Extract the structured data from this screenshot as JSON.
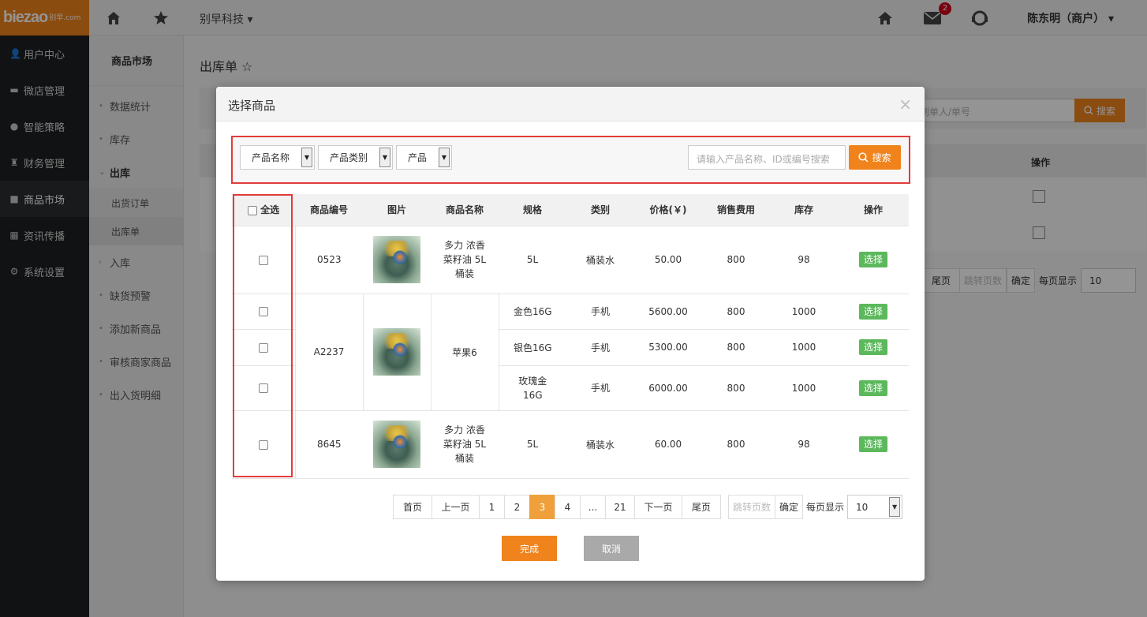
{
  "logo": {
    "text": "biezao",
    "small": "别早.com"
  },
  "sidebar": {
    "items": [
      {
        "label": "用户中心",
        "icon": "user-icon",
        "glyph": "👤"
      },
      {
        "label": "微店管理",
        "icon": "store-icon",
        "glyph": "▬"
      },
      {
        "label": "智能策略",
        "icon": "strategy-icon",
        "glyph": "●"
      },
      {
        "label": "财务管理",
        "icon": "finance-icon",
        "glyph": "♜"
      },
      {
        "label": "商品市场",
        "icon": "market-icon",
        "glyph": "■"
      },
      {
        "label": "资讯传播",
        "icon": "news-icon",
        "glyph": "▦"
      },
      {
        "label": "系统设置",
        "icon": "settings-icon",
        "glyph": "⚙"
      }
    ]
  },
  "topbar": {
    "company": "别早科技 ▾",
    "user": "陈东明（商户） ▾",
    "mail_badge": "2"
  },
  "subnav": {
    "title": "商品市场",
    "items": {
      "stats": "数据统计",
      "stock": "库存",
      "outbound": "出库",
      "out_order": "出货订单",
      "out_list": "出库单",
      "inbound": "入库",
      "shortage": "缺货预警",
      "add_new": "添加新商品",
      "review": "审核商家商品",
      "detail": "出入货明细"
    }
  },
  "page": {
    "title": "出库单 ☆",
    "search_placeholder": "刷单人/单号",
    "search_button": "搜索",
    "bg_op_header": "操作",
    "bg_pager": {
      "last": "尾页",
      "jump": "跳转页数",
      "confirm": "确定",
      "per_page": "每页显示",
      "per_page_value": "10"
    }
  },
  "modal": {
    "title": "选择商品",
    "close": "×",
    "filters": {
      "name": "产品名称",
      "category": "产品类别",
      "product": "产品"
    },
    "search_placeholder": "请输入产品名称、ID或编号搜索",
    "search_button": "搜索",
    "headers": {
      "select_all": "全选",
      "code": "商品编号",
      "image": "图片",
      "name": "商品名称",
      "spec": "规格",
      "type": "类别",
      "price": "价格(￥)",
      "sales_fee": "销售费用",
      "stock": "库存",
      "action": "操作"
    },
    "select_label": "选择",
    "rows": {
      "r1": {
        "code": "0523",
        "name": "多力 浓香菜籽油 5L桶装",
        "spec": "5L",
        "type": "桶装水",
        "price": "50.00",
        "fee": "800",
        "stock": "98"
      },
      "r2": {
        "code": "A2237",
        "name": "苹果6",
        "variants": {
          "v1": {
            "spec": "金色16G",
            "type": "手机",
            "price": "5600.00",
            "fee": "800",
            "stock": "1000"
          },
          "v2": {
            "spec": "银色16G",
            "type": "手机",
            "price": "5300.00",
            "fee": "800",
            "stock": "1000"
          },
          "v3": {
            "spec": "玫瑰金16G",
            "type": "手机",
            "price": "6000.00",
            "fee": "800",
            "stock": "1000"
          }
        }
      },
      "r3": {
        "code": "8645",
        "name": "多力 浓香菜籽油 5L桶装",
        "spec": "5L",
        "type": "桶装水",
        "price": "60.00",
        "fee": "800",
        "stock": "98"
      }
    },
    "pager": {
      "first": "首页",
      "prev": "上一页",
      "p1": "1",
      "p2": "2",
      "p3": "3",
      "p4": "4",
      "ellipsis": "...",
      "p21": "21",
      "next": "下一页",
      "last": "尾页",
      "jump": "跳转页数",
      "confirm": "确定",
      "per_page": "每页显示",
      "per_page_value": "10"
    },
    "done": "完成",
    "cancel": "取消"
  },
  "colors": {
    "accent": "#f0831b",
    "select_green": "#5cb85c",
    "highlight_red": "#e23b3b",
    "active_page": "#f0a03a"
  }
}
